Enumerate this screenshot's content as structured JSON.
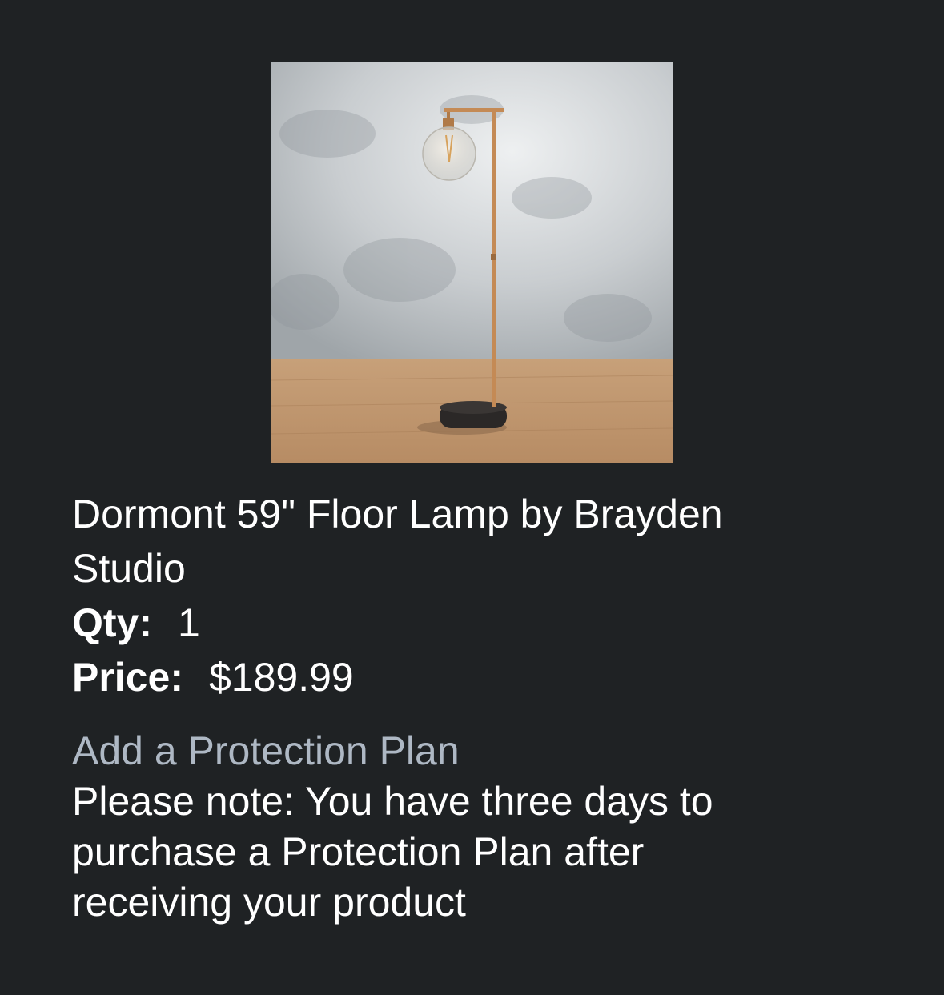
{
  "product": {
    "image_icon": "floor-lamp-photo",
    "title": "Dormont 59\" Floor Lamp by Brayden Studio",
    "qty_label": "Qty:",
    "qty_value": "1",
    "price_label": "Price:",
    "price_value": "$189.99"
  },
  "protection": {
    "link_label": "Add a Protection Plan",
    "note": "Please note: You have three days to purchase a Protection Plan after receiving your product"
  },
  "colors": {
    "background": "#1f2224",
    "text": "#ffffff",
    "link": "#aeb8c4"
  }
}
